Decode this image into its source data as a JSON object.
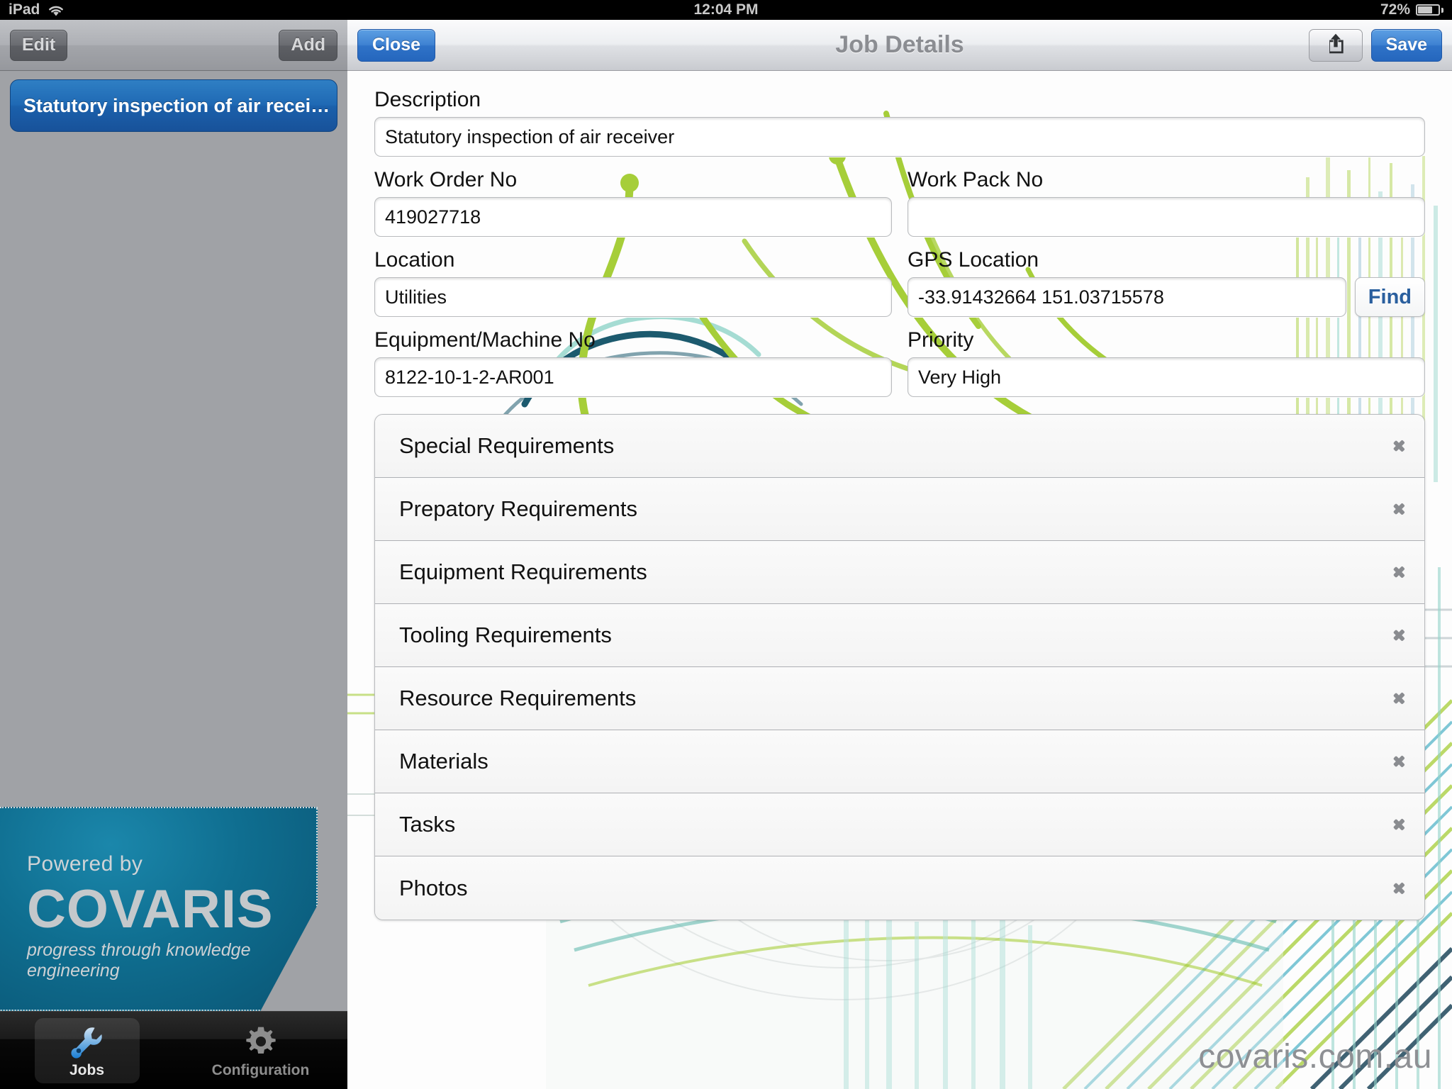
{
  "statusbar": {
    "device": "iPad",
    "wifi_icon": "wifi-icon",
    "time": "12:04 PM",
    "battery_percent": "72%",
    "battery_icon": "battery-icon"
  },
  "master": {
    "toolbar": {
      "edit_label": "Edit",
      "add_label": "Add"
    },
    "rows": [
      {
        "title": "Statutory inspection of air recei…",
        "selected": true
      }
    ],
    "brand": {
      "powered_by": "Powered by",
      "name": "COVARIS",
      "tagline": "progress through knowledge engineering"
    },
    "tabs": [
      {
        "label": "Jobs",
        "icon": "wrench-icon",
        "selected": true
      },
      {
        "label": "Configuration",
        "icon": "gear-icon",
        "selected": false
      }
    ]
  },
  "detail": {
    "nav": {
      "close_label": "Close",
      "title": "Job Details",
      "share_icon": "share-icon",
      "save_label": "Save"
    },
    "fields": {
      "description": {
        "label": "Description",
        "value": "Statutory inspection of air receiver",
        "placeholder": ""
      },
      "work_order_no": {
        "label": "Work Order No",
        "value": "419027718",
        "placeholder": ""
      },
      "work_pack_no": {
        "label": "Work Pack No",
        "value": "",
        "placeholder": ""
      },
      "location": {
        "label": "Location",
        "value": "Utilities",
        "placeholder": ""
      },
      "gps_location": {
        "label": "GPS Location",
        "value": "-33.91432664 151.03715578",
        "placeholder": "",
        "find_label": "Find"
      },
      "equipment_no": {
        "label": "Equipment/Machine No",
        "value": "8122-10-1-2-AR001",
        "placeholder": ""
      },
      "priority": {
        "label": "Priority",
        "value": "Very High",
        "placeholder": ""
      }
    },
    "list": [
      {
        "label": "Special Requirements",
        "chevron": "chevron-right-icon"
      },
      {
        "label": "Prepatory Requirements",
        "chevron": "chevron-right-icon"
      },
      {
        "label": "Equipment Requirements",
        "chevron": "chevron-right-icon"
      },
      {
        "label": "Tooling Requirements",
        "chevron": "chevron-right-icon"
      },
      {
        "label": "Resource Requirements",
        "chevron": "chevron-right-icon"
      },
      {
        "label": "Materials",
        "chevron": "chevron-right-icon"
      },
      {
        "label": "Tasks",
        "chevron": "chevron-right-icon"
      },
      {
        "label": "Photos",
        "chevron": "chevron-right-icon"
      }
    ],
    "site_url": "covaris.com.au"
  },
  "colors": {
    "accent_blue": "#2566bd",
    "selected_row_blue": "#1f69b4",
    "brand_teal": "#0f6e90",
    "art_green": "#a6ce39",
    "find_blue": "#2a5f9e"
  }
}
